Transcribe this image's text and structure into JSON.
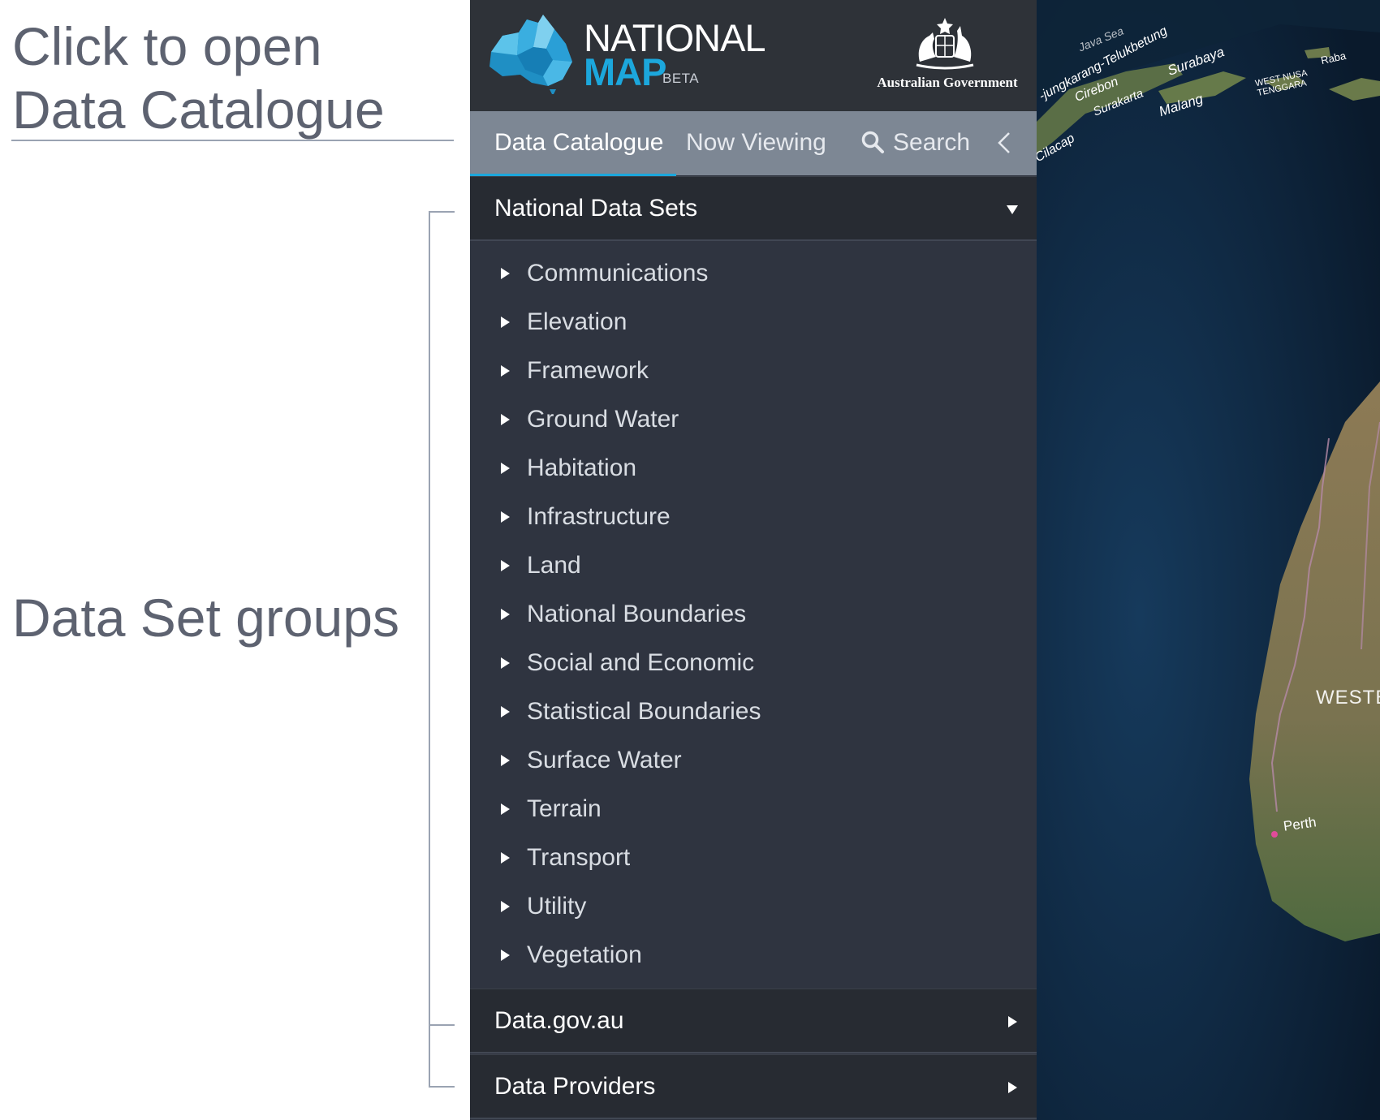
{
  "annotations": {
    "title_line1": "Click to open",
    "title_line2": "Data Catalogue",
    "groups_label": "Data Set groups"
  },
  "header": {
    "logo_national": "NATIONAL",
    "logo_map": "MAP",
    "logo_beta": "BETA",
    "government": "Australian Government"
  },
  "tabs": {
    "catalogue": "Data Catalogue",
    "now_viewing": "Now Viewing",
    "search": "Search"
  },
  "groups": {
    "national": "National Data Sets",
    "datagov": "Data.gov.au",
    "providers": "Data Providers"
  },
  "datasets": [
    "Communications",
    "Elevation",
    "Framework",
    "Ground Water",
    "Habitation",
    "Infrastructure",
    "Land",
    "National Boundaries",
    "Social and Economic",
    "Statistical Boundaries",
    "Surface Water",
    "Terrain",
    "Transport",
    "Utility",
    "Vegetation"
  ],
  "map": {
    "labels": [
      "Java Sea",
      "-jungkarang-Telukbetung",
      "Surabaya",
      "Cirebon",
      "Surakarta",
      "Malang",
      "Cilacap",
      "WEST NUSA TENGGARA",
      "Raba",
      "WESTE",
      "Perth"
    ]
  },
  "colors": {
    "accent": "#1ca7dc",
    "panel_bg": "#2f3440",
    "tab_bar": "#7d8794",
    "annotation_text": "#5d6270"
  }
}
